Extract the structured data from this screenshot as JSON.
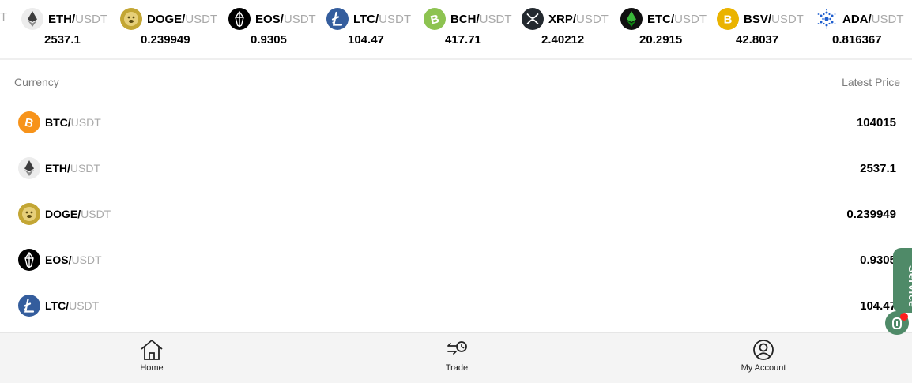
{
  "ticker": {
    "partial_text": "T",
    "items": [
      {
        "base": "ETH/",
        "quote": "USDT",
        "price": "2537.1",
        "icon": "eth-icon"
      },
      {
        "base": "DOGE/",
        "quote": "USDT",
        "price": "0.239949",
        "icon": "doge-icon"
      },
      {
        "base": "EOS/",
        "quote": "USDT",
        "price": "0.9305",
        "icon": "eos-icon"
      },
      {
        "base": "LTC/",
        "quote": "USDT",
        "price": "104.47",
        "icon": "ltc-icon"
      },
      {
        "base": "BCH/",
        "quote": "USDT",
        "price": "417.71",
        "icon": "bch-icon"
      },
      {
        "base": "XRP/",
        "quote": "USDT",
        "price": "2.40212",
        "icon": "xrp-icon"
      },
      {
        "base": "ETC/",
        "quote": "USDT",
        "price": "20.2915",
        "icon": "etc-icon"
      },
      {
        "base": "BSV/",
        "quote": "USDT",
        "price": "42.8037",
        "icon": "bsv-icon"
      },
      {
        "base": "ADA/",
        "quote": "USDT",
        "price": "0.816367",
        "icon": "ada-icon"
      }
    ]
  },
  "list": {
    "header_left": "Currency",
    "header_right": "Latest Price",
    "rows": [
      {
        "base": "BTC/",
        "quote": "USDT",
        "price": "104015",
        "icon": "btc-icon"
      },
      {
        "base": "ETH/",
        "quote": "USDT",
        "price": "2537.1",
        "icon": "eth-icon"
      },
      {
        "base": "DOGE/",
        "quote": "USDT",
        "price": "0.239949",
        "icon": "doge-icon"
      },
      {
        "base": "EOS/",
        "quote": "USDT",
        "price": "0.9305",
        "icon": "eos-icon"
      },
      {
        "base": "LTC/",
        "quote": "USDT",
        "price": "104.47",
        "icon": "ltc-icon"
      }
    ]
  },
  "service": {
    "label": "Service",
    "color": "#4f8a68",
    "badge_color": "#ff1e1e"
  },
  "nav": {
    "home": {
      "label": "Home",
      "icon": "home-icon"
    },
    "trade": {
      "label": "Trade",
      "icon": "trade-icon"
    },
    "account": {
      "label": "My Account",
      "icon": "account-icon"
    }
  },
  "colors": {
    "quote_text": "#a9a9a9",
    "header_text": "#7b7b7b",
    "nav_background": "#f4f4f4"
  }
}
